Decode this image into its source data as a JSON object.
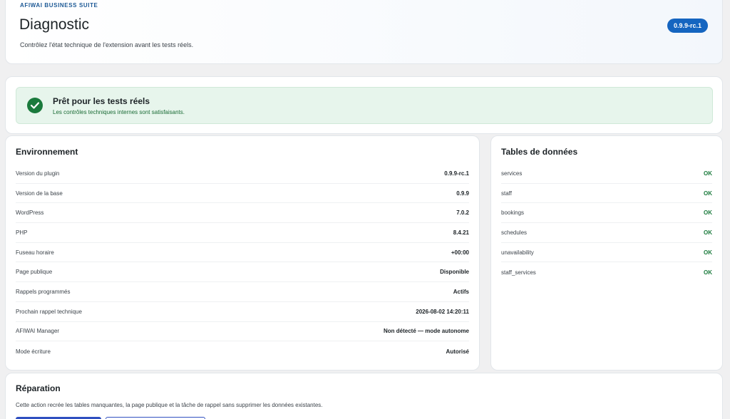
{
  "header": {
    "eyebrow": "AFIWAI BUSINESS SUITE",
    "title": "Diagnostic",
    "subtitle": "Contrôlez l'état technique de l'extension avant les tests réels.",
    "version": "0.9.9-rc.1"
  },
  "status": {
    "icon": "check-circle-icon",
    "title": "Prêt pour les tests réels",
    "description": "Les contrôles techniques internes sont satisfaisants.",
    "color": "#1a7a3c"
  },
  "environment": {
    "title": "Environnement",
    "rows": [
      {
        "label": "Version du plugin",
        "value": "0.9.9-rc.1"
      },
      {
        "label": "Version de la base",
        "value": "0.9.9"
      },
      {
        "label": "WordPress",
        "value": "7.0.2"
      },
      {
        "label": "PHP",
        "value": "8.4.21"
      },
      {
        "label": "Fuseau horaire",
        "value": "+00:00"
      },
      {
        "label": "Page publique",
        "value": "Disponible"
      },
      {
        "label": "Rappels programmés",
        "value": "Actifs"
      },
      {
        "label": "Prochain rappel technique",
        "value": "2026-08-02 14:20:11"
      },
      {
        "label": "AFIWAI Manager",
        "value": "Non détecté — mode autonome"
      },
      {
        "label": "Mode écriture",
        "value": "Autorisé"
      }
    ]
  },
  "tables": {
    "title": "Tables de données",
    "rows": [
      {
        "label": "services",
        "value": "OK"
      },
      {
        "label": "staff",
        "value": "OK"
      },
      {
        "label": "bookings",
        "value": "OK"
      },
      {
        "label": "schedules",
        "value": "OK"
      },
      {
        "label": "unavailability",
        "value": "OK"
      },
      {
        "label": "staff_services",
        "value": "OK"
      }
    ]
  },
  "repair": {
    "title": "Réparation",
    "description": "Cette action recrée les tables manquantes, la page publique et la tâche de rappel sans supprimer les données existantes.",
    "primary_label": "",
    "secondary_label": ""
  }
}
